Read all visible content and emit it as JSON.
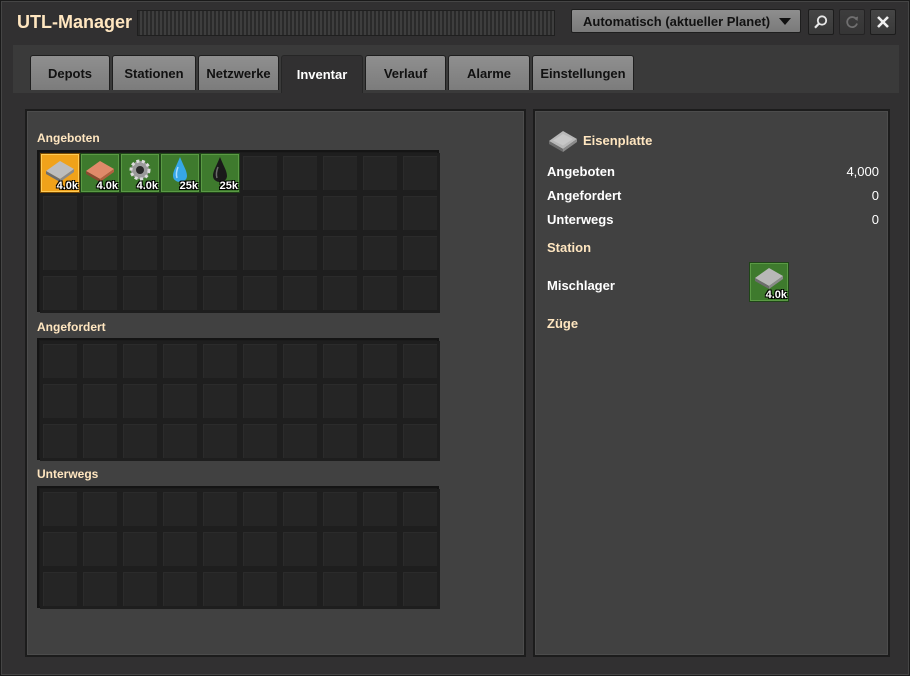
{
  "title": "UTL-Manager",
  "surface_dropdown": {
    "value": "Automatisch (aktueller Planet)"
  },
  "tabs": [
    {
      "label": "Depots"
    },
    {
      "label": "Stationen"
    },
    {
      "label": "Netzwerke"
    },
    {
      "label": "Inventar",
      "active": true
    },
    {
      "label": "Verlauf"
    },
    {
      "label": "Alarme"
    },
    {
      "label": "Einstellungen"
    }
  ],
  "inventory": {
    "provided_label": "Angeboten",
    "requested_label": "Angefordert",
    "in_transit_label": "Unterwegs",
    "provided_items": [
      {
        "icon": "iron-plate-icon",
        "count": "4.0k",
        "selected": true
      },
      {
        "icon": "copper-plate-icon",
        "count": "4.0k"
      },
      {
        "icon": "iron-gear-wheel-icon",
        "count": "4.0k"
      },
      {
        "icon": "water-icon",
        "count": "25k"
      },
      {
        "icon": "crude-oil-icon",
        "count": "25k"
      }
    ]
  },
  "details": {
    "item_name": "Eisenplatte",
    "item_icon": "iron-plate-icon",
    "provided_label": "Angeboten",
    "provided_value": "4,000",
    "requested_label": "Angefordert",
    "requested_value": "0",
    "in_transit_label": "Unterwegs",
    "in_transit_value": "0",
    "station_header": "Station",
    "station_name": "Mischlager",
    "station_item_count": "4.0k",
    "trains_header": "Züge"
  }
}
